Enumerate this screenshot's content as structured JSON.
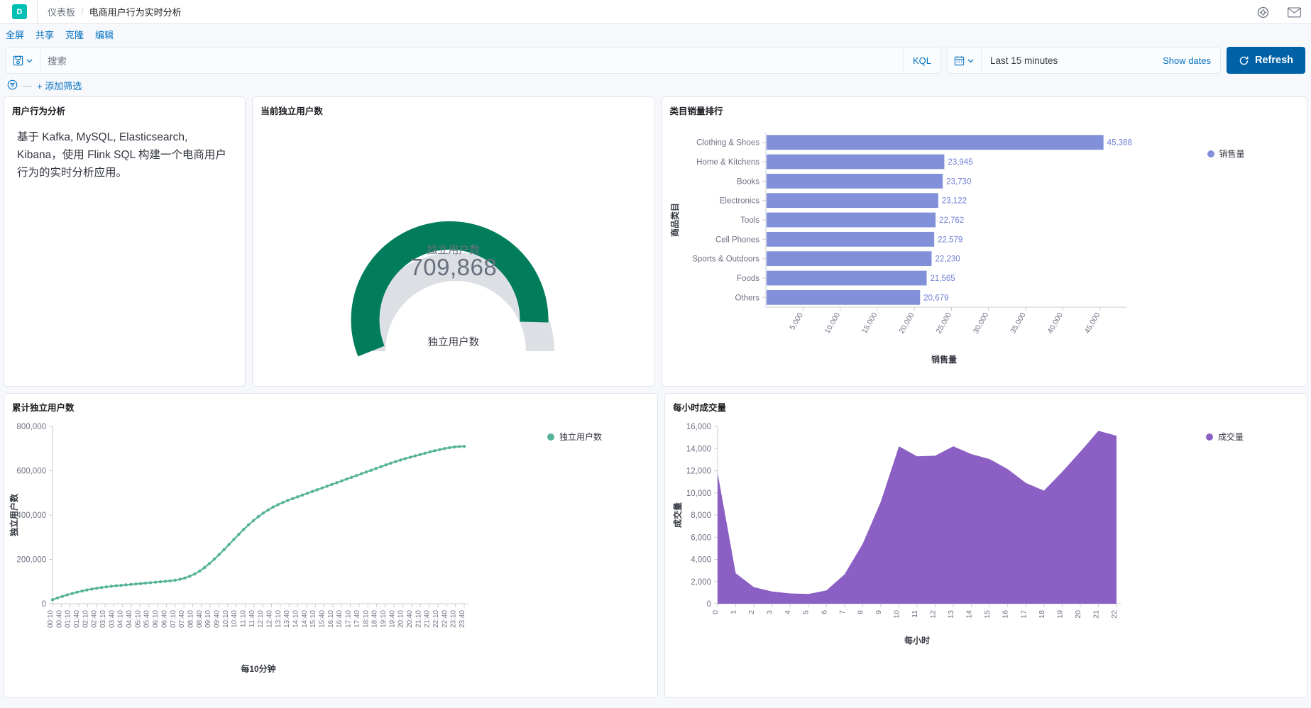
{
  "header": {
    "app_initial": "D",
    "breadcrumb_root": "仪表板",
    "breadcrumb_sep": "/",
    "breadcrumb_current": "电商用户行为实时分析",
    "help_icon": "help-circle-icon",
    "mail_icon": "mail-icon"
  },
  "actions": {
    "fullscreen": "全屏",
    "share": "共享",
    "clone": "克隆",
    "edit": "编辑"
  },
  "query": {
    "saved_query_icon": "save-disk-icon",
    "chevron_icon": "chevron-down-icon",
    "placeholder": "搜索",
    "value": "",
    "language": "KQL",
    "calendar_icon": "calendar-icon",
    "date_range": "Last 15 minutes",
    "show_dates": "Show dates",
    "refresh_icon": "refresh-icon",
    "refresh": "Refresh"
  },
  "filters": {
    "filter_icon": "filter-icon",
    "dash": "—",
    "add_filter": "+ 添加筛选"
  },
  "panels": {
    "markdown": {
      "title": "用户行为分析",
      "body": "基于 Kafka, MySQL, Elasticsearch, Kibana，使用 Flink SQL 构建一个电商用户行为的实时分析应用。"
    },
    "gauge": {
      "title": "当前独立用户数",
      "metric_label": "独立用户数",
      "metric_value": "709,868",
      "bottom_label": "独立用户数"
    },
    "bar": {
      "title": "类目销量排行"
    },
    "line": {
      "title": "累计独立用户数"
    },
    "area": {
      "title": "每小时成交量"
    }
  },
  "colors": {
    "gauge_fill": "#017d5c",
    "gauge_track": "#dcdfe4",
    "bar": "#8290d9",
    "line": "#54b399",
    "area": "#8b5fc4",
    "accent": "#0071c2",
    "brand": "#00bfb3"
  },
  "chart_data": [
    {
      "type": "gauge",
      "title": "当前独立用户数",
      "label": "独立用户数",
      "value": 709868,
      "value_text": "709,868",
      "min": 0,
      "max": 1000000,
      "percent_of_arc": 0.78
    },
    {
      "type": "bar",
      "orientation": "horizontal",
      "title": "类目销量排行",
      "xlabel": "销售量",
      "ylabel": "商品类目",
      "legend": [
        "销售量"
      ],
      "legend_position": "right",
      "grid": false,
      "xlim": [
        0,
        48000
      ],
      "xticks": [
        5000,
        10000,
        15000,
        20000,
        25000,
        30000,
        35000,
        40000,
        45000
      ],
      "xtick_labels": [
        "5,000",
        "10,000",
        "15,000",
        "20,000",
        "25,000",
        "30,000",
        "35,000",
        "40,000",
        "45,000"
      ],
      "categories": [
        "Clothing & Shoes",
        "Home & Kitchens",
        "Books",
        "Electronics",
        "Tools",
        "Cell Phones",
        "Sports & Outdoors",
        "Foods",
        "Others"
      ],
      "values": [
        45388,
        23945,
        23730,
        23122,
        22762,
        22579,
        22230,
        21565,
        20679
      ],
      "value_labels": [
        "45,388",
        "23,945",
        "23,730",
        "23,122",
        "22,762",
        "22,579",
        "22,230",
        "21,565",
        "20,679"
      ]
    },
    {
      "type": "line",
      "title": "累计独立用户数",
      "xlabel": "每10分钟",
      "ylabel": "独立用户数",
      "legend": [
        "独立用户数"
      ],
      "legend_position": "top-right",
      "ylim": [
        0,
        800000
      ],
      "yticks": [
        0,
        200000,
        400000,
        600000,
        800000
      ],
      "ytick_labels": [
        "0",
        "200,000",
        "400,000",
        "600,000",
        "800,000"
      ],
      "xtick_labels": [
        "00:10",
        "00:40",
        "01:10",
        "01:40",
        "02:10",
        "02:40",
        "03:10",
        "03:40",
        "04:10",
        "04:40",
        "05:10",
        "05:40",
        "06:10",
        "06:40",
        "07:10",
        "07:40",
        "08:10",
        "08:40",
        "09:10",
        "09:40",
        "10:10",
        "10:40",
        "11:10",
        "11:40",
        "12:10",
        "12:40",
        "13:10",
        "13:40",
        "14:10",
        "14:40",
        "15:10",
        "15:40",
        "16:10",
        "16:40",
        "17:10",
        "17:40",
        "18:10",
        "18:40",
        "19:10",
        "19:40",
        "20:10",
        "20:40",
        "21:10",
        "21:40",
        "22:10",
        "22:40",
        "23:10",
        "23:40"
      ],
      "values": [
        18000,
        26000,
        33000,
        40000,
        46000,
        52000,
        57000,
        62000,
        66000,
        70000,
        73000,
        76000,
        79000,
        81000,
        83000,
        85000,
        87000,
        89000,
        91000,
        93000,
        95000,
        97000,
        99000,
        101000,
        103000,
        106000,
        110000,
        116000,
        124000,
        134000,
        147000,
        163000,
        181000,
        201000,
        222000,
        244000,
        267000,
        290000,
        313000,
        335000,
        356000,
        375000,
        393000,
        409000,
        423000,
        436000,
        447000,
        457000,
        466000,
        474000,
        482000,
        490000,
        498000,
        506000,
        514000,
        522000,
        530000,
        538000,
        546000,
        554000,
        562000,
        570000,
        578000,
        586000,
        594000,
        602000,
        610000,
        618000,
        626000,
        634000,
        641000,
        648000,
        655000,
        661000,
        667000,
        673000,
        679000,
        685000,
        690000,
        695000,
        700000,
        704000,
        707000,
        709000,
        709868
      ]
    },
    {
      "type": "area",
      "title": "每小时成交量",
      "xlabel": "每小时",
      "ylabel": "成交量",
      "legend": [
        "成交量"
      ],
      "legend_position": "right",
      "ylim": [
        0,
        16000
      ],
      "yticks": [
        0,
        2000,
        4000,
        6000,
        8000,
        10000,
        12000,
        14000,
        16000
      ],
      "ytick_labels": [
        "0",
        "2,000",
        "4,000",
        "6,000",
        "8,000",
        "10,000",
        "12,000",
        "14,000",
        "16,000"
      ],
      "x": [
        0,
        1,
        2,
        3,
        4,
        5,
        6,
        7,
        8,
        9,
        10,
        11,
        12,
        13,
        14,
        15,
        16,
        17,
        18,
        19,
        20,
        21,
        22
      ],
      "xtick_labels": [
        "0",
        "1",
        "2",
        "3",
        "4",
        "5",
        "6",
        "7",
        "8",
        "9",
        "10",
        "11",
        "12",
        "13",
        "14",
        "15",
        "16",
        "17",
        "18",
        "19",
        "20",
        "21",
        "22"
      ],
      "values": [
        11800,
        2750,
        1500,
        1100,
        930,
        880,
        1200,
        2650,
        5400,
        9200,
        14200,
        13300,
        13350,
        14200,
        13500,
        13050,
        12150,
        10900,
        10200,
        11900,
        13700,
        15600,
        15150
      ]
    }
  ]
}
